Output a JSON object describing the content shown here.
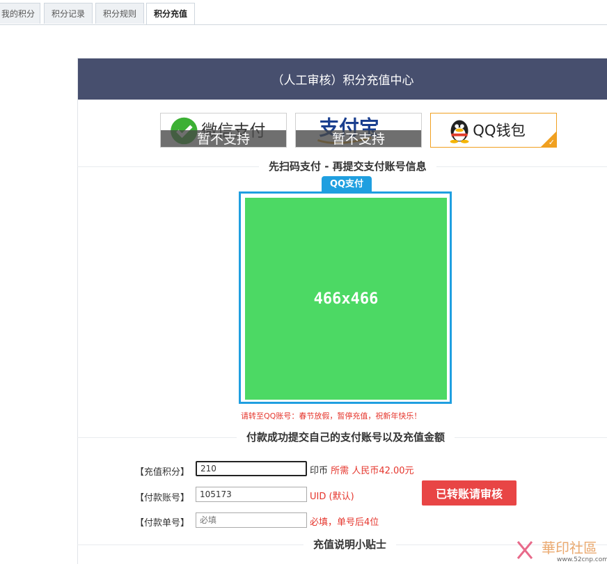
{
  "tabs": [
    {
      "label": "我的积分"
    },
    {
      "label": "积分记录"
    },
    {
      "label": "积分规则"
    },
    {
      "label": "积分充值"
    }
  ],
  "header": {
    "title": "（人工审核）积分充值中心"
  },
  "payments": {
    "wechat": {
      "brand": "微信支付",
      "status": "暂不支持"
    },
    "alipay": {
      "brand": "支付宝",
      "status": "暂不支持"
    },
    "qq": {
      "brand": "QQ钱包"
    }
  },
  "section1": {
    "title": "先扫码支付 - 再提交支付账号信息"
  },
  "qr": {
    "badge": "QQ支付",
    "placeholder": "466x466"
  },
  "notice": "请转至QQ账号：春节放假，暂停充值，祝新年快乐！",
  "section2": {
    "title": "付款成功提交自己的支付账号以及充值金额"
  },
  "form": {
    "points": {
      "label": "【充值积分】",
      "value": "210",
      "unit": "印币",
      "need_label": "所需",
      "need_value": "人民币42.00元"
    },
    "account": {
      "label": "【付款账号】",
      "value": "105173",
      "hint": "UID (默认)"
    },
    "order": {
      "label": "【付款单号】",
      "placeholder": "必填",
      "hint": "必填，单号后4位"
    },
    "submit": "已转账请审核"
  },
  "section3": {
    "title": "充值说明小贴士"
  },
  "watermark": {
    "text": "華印社區",
    "url": "www.52cnp.com"
  },
  "colors": {
    "header": "#474f6e",
    "qq_blue": "#1f9fe0",
    "qr_green": "#4cd964",
    "red": "#e5352c",
    "selected": "#f0a020"
  }
}
